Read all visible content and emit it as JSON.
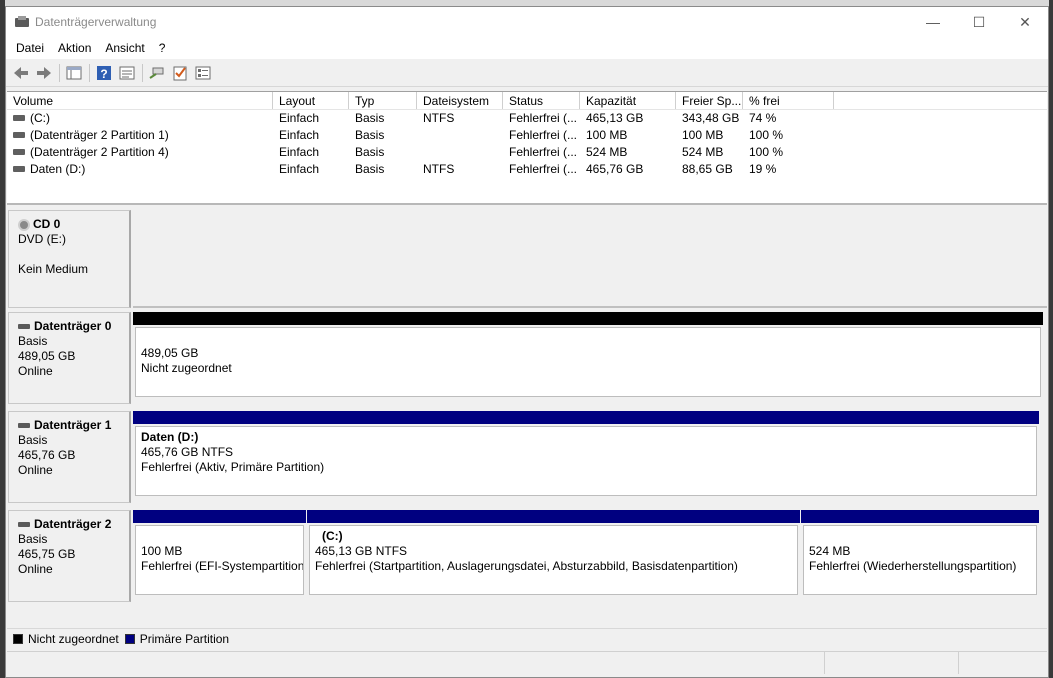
{
  "window": {
    "title": "Datenträgerverwaltung",
    "controls": {
      "minimize": "—",
      "maximize": "☐",
      "close": "✕"
    }
  },
  "menu": [
    "Datei",
    "Aktion",
    "Ansicht",
    "?"
  ],
  "toolbar": {
    "buttons": [
      "back-icon",
      "forward-icon",
      "console-tree-icon",
      "help-icon",
      "properties-icon",
      "connect-icon",
      "check-icon",
      "list-icon"
    ]
  },
  "volume_list": {
    "columns": [
      "Volume",
      "Layout",
      "Typ",
      "Dateisystem",
      "Status",
      "Kapazität",
      "Freier Sp...",
      "% frei"
    ],
    "rows": [
      [
        "(C:)",
        "Einfach",
        "Basis",
        "NTFS",
        "Fehlerfrei (...",
        "465,13 GB",
        "343,48 GB",
        "74 %"
      ],
      [
        "(Datenträger 2 Partition 1)",
        "Einfach",
        "Basis",
        "",
        "Fehlerfrei (...",
        "100 MB",
        "100 MB",
        "100 %"
      ],
      [
        "(Datenträger 2 Partition 4)",
        "Einfach",
        "Basis",
        "",
        "Fehlerfrei (...",
        "524 MB",
        "524 MB",
        "100 %"
      ],
      [
        "Daten (D:)",
        "Einfach",
        "Basis",
        "NTFS",
        "Fehlerfrei (...",
        "465,76 GB",
        "88,65 GB",
        "19 %"
      ]
    ]
  },
  "disks": {
    "cd0": {
      "name": "CD 0",
      "type": "DVD (E:)",
      "media": "Kein Medium"
    },
    "disk0": {
      "name": "Datenträger 0",
      "type": "Basis",
      "size": "489,05 GB",
      "state": "Online",
      "partitions": [
        {
          "line1": "489,05 GB",
          "line2": "Nicht zugeordnet"
        }
      ]
    },
    "disk1": {
      "name": "Datenträger 1",
      "type": "Basis",
      "size": "465,76 GB",
      "state": "Online",
      "partitions": [
        {
          "name": "Daten  (D:)",
          "line1": "465,76 GB NTFS",
          "line2": "Fehlerfrei (Aktiv, Primäre Partition)"
        }
      ]
    },
    "disk2": {
      "name": "Datenträger 2",
      "type": "Basis",
      "size": "465,75 GB",
      "state": "Online",
      "partitions": [
        {
          "line1": "100 MB",
          "line2": "Fehlerfrei (EFI-Systempartition)"
        },
        {
          "name": "(C:)",
          "line1": "465,13 GB NTFS",
          "line2": "Fehlerfrei (Startpartition, Auslagerungsdatei, Absturzabbild, Basisdatenpartition)"
        },
        {
          "line1": "524 MB",
          "line2": "Fehlerfrei (Wiederherstellungspartition)"
        }
      ]
    }
  },
  "legend": {
    "unallocated": {
      "label": "Nicht zugeordnet",
      "color": "#000000"
    },
    "primary": {
      "label": "Primäre Partition",
      "color": "#000080"
    }
  }
}
